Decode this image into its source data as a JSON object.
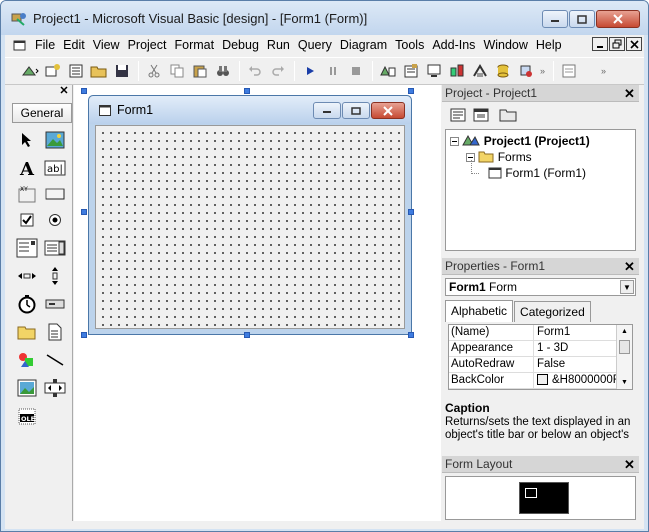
{
  "window": {
    "title": "Project1 - Microsoft Visual Basic [design] - [Form1 (Form)]"
  },
  "menu": [
    "File",
    "Edit",
    "View",
    "Project",
    "Format",
    "Debug",
    "Run",
    "Query",
    "Diagram",
    "Tools",
    "Add-Ins",
    "Window",
    "Help"
  ],
  "toolbox": {
    "tab_label": "General"
  },
  "form_designer": {
    "caption": "Form1"
  },
  "project_panel": {
    "title": "Project - Project1",
    "tree": {
      "root": "Project1 (Project1)",
      "folder": "Forms",
      "item": "Form1 (Form1)"
    }
  },
  "properties_panel": {
    "title": "Properties - Form1",
    "object_name": "Form1",
    "object_type": "Form",
    "tabs": [
      "Alphabetic",
      "Categorized"
    ],
    "rows": [
      {
        "name": "(Name)",
        "value": "Form1"
      },
      {
        "name": "Appearance",
        "value": "1 - 3D"
      },
      {
        "name": "AutoRedraw",
        "value": "False"
      },
      {
        "name": "BackColor",
        "value": "&H8000000F"
      }
    ],
    "description_title": "Caption",
    "description_text": "Returns/sets the text displayed in an object's title bar or below an object's"
  },
  "layout_panel": {
    "title": "Form Layout"
  },
  "colors": {
    "title_bar": "#c2d6ee",
    "close_button": "#c64a33",
    "handle_focus": "#3e7ce0"
  }
}
